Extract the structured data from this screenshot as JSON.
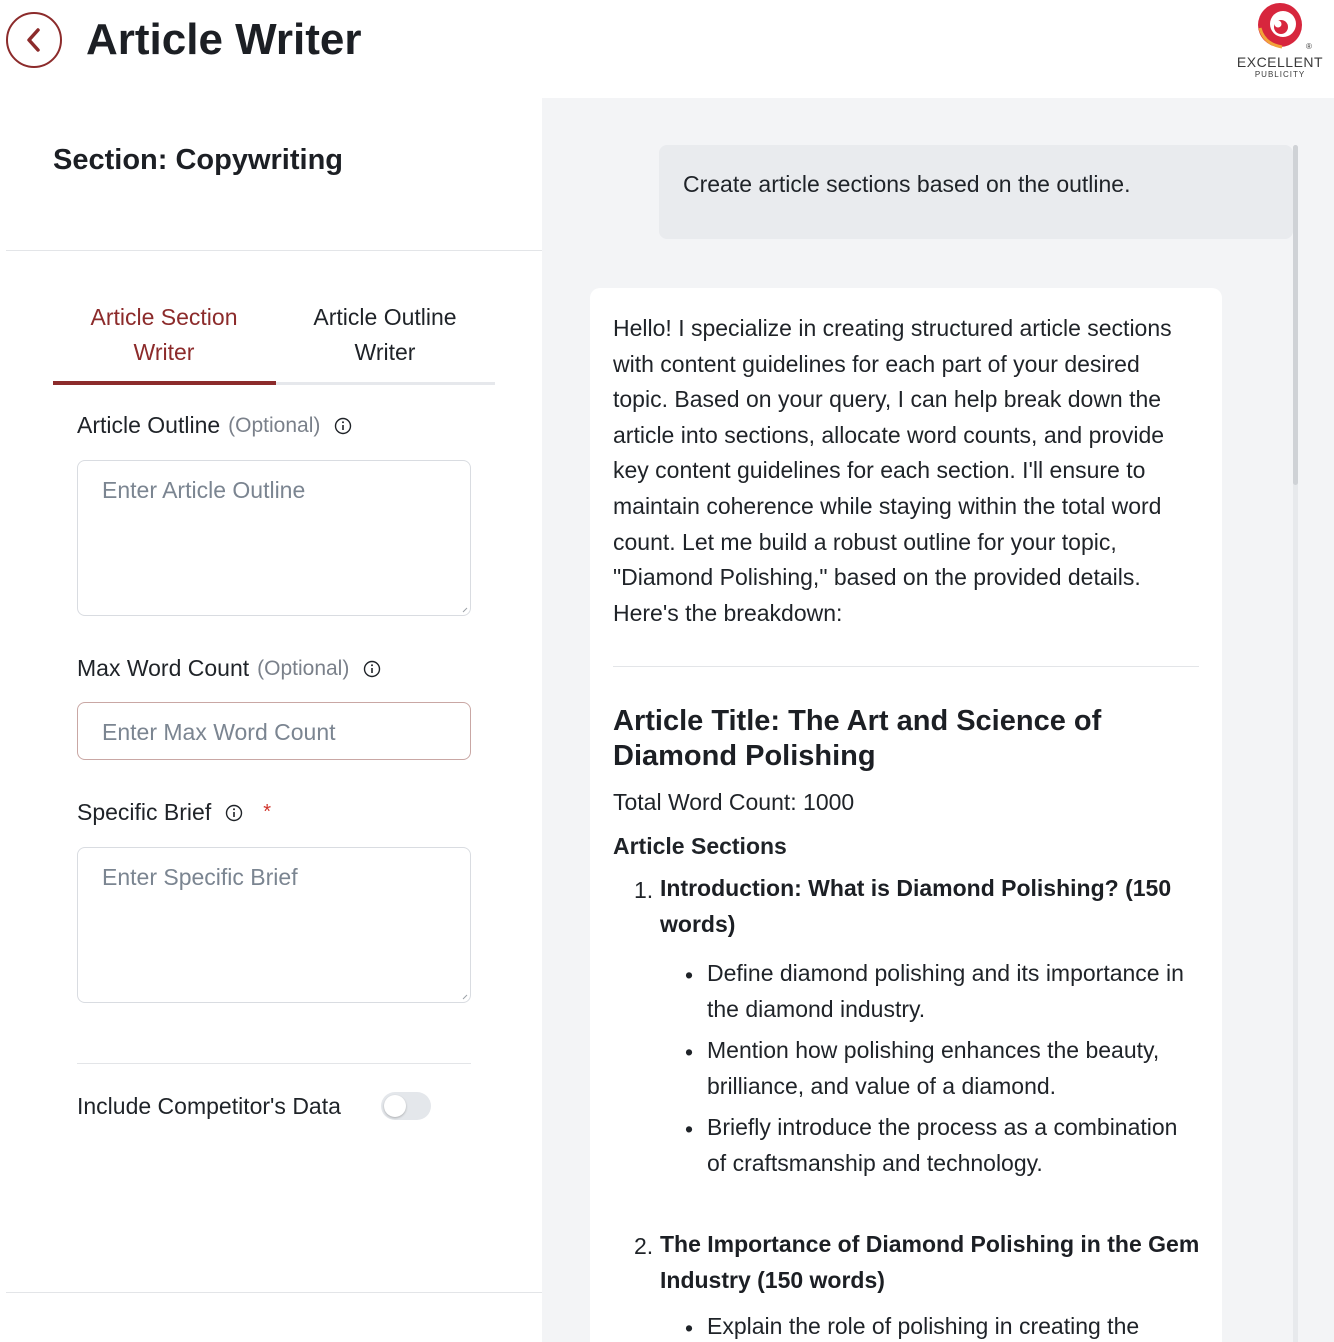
{
  "header": {
    "title": "Article Writer",
    "back_icon": "chevron-left-icon",
    "logo": {
      "name": "EXCELLENT",
      "sub": "PUBLICITY",
      "registered": "®"
    },
    "accent_color": "#8c2b2b"
  },
  "left": {
    "section_title": "Section: Copywriting",
    "tabs": [
      {
        "label_line1": "Article Section",
        "label_line2": "Writer",
        "active": true
      },
      {
        "label_line1": "Article Outline",
        "label_line2": "Writer",
        "active": false
      }
    ],
    "outline": {
      "label": "Article Outline",
      "optional": "(Optional)",
      "placeholder": "Enter Article Outline",
      "value": ""
    },
    "max_words": {
      "label": "Max Word Count",
      "optional": "(Optional)",
      "placeholder": "Enter Max Word Count",
      "value": ""
    },
    "brief": {
      "label": "Specific Brief",
      "required": "*",
      "placeholder": "Enter Specific Brief",
      "value": ""
    },
    "competitor": {
      "label": "Include Competitor's Data",
      "on": false
    }
  },
  "chat": {
    "user_message": "Create article sections based on the outline.",
    "reply": {
      "intro": "Hello! I specialize in creating structured article sections with content guidelines for each part of your desired topic. Based on your query, I can help break down the article into sections, allocate word counts, and provide key content guidelines for each section. I'll ensure to maintain coherence while staying within the total word count. Let me build a robust outline for your topic, \"Diamond Polishing,\" based on the provided details. Here's the breakdown:",
      "article_title": "Article Title: The Art and Science of Diamond Polishing",
      "word_count": "Total Word Count: 1000",
      "sections_heading": "Article Sections",
      "sections": [
        {
          "num": "1.",
          "title": "Introduction: What is Diamond Polishing? (150 words)",
          "bullets": [
            "Define diamond polishing and its importance in the diamond industry.",
            "Mention how polishing enhances the beauty, brilliance, and value of a diamond.",
            "Briefly introduce the process as a combination of craftsmanship and technology."
          ]
        },
        {
          "num": "2.",
          "title": "The Importance of Diamond Polishing in the Gem Industry (150 words)",
          "bullets": [
            "Explain the role of polishing in creating the"
          ]
        }
      ]
    }
  }
}
